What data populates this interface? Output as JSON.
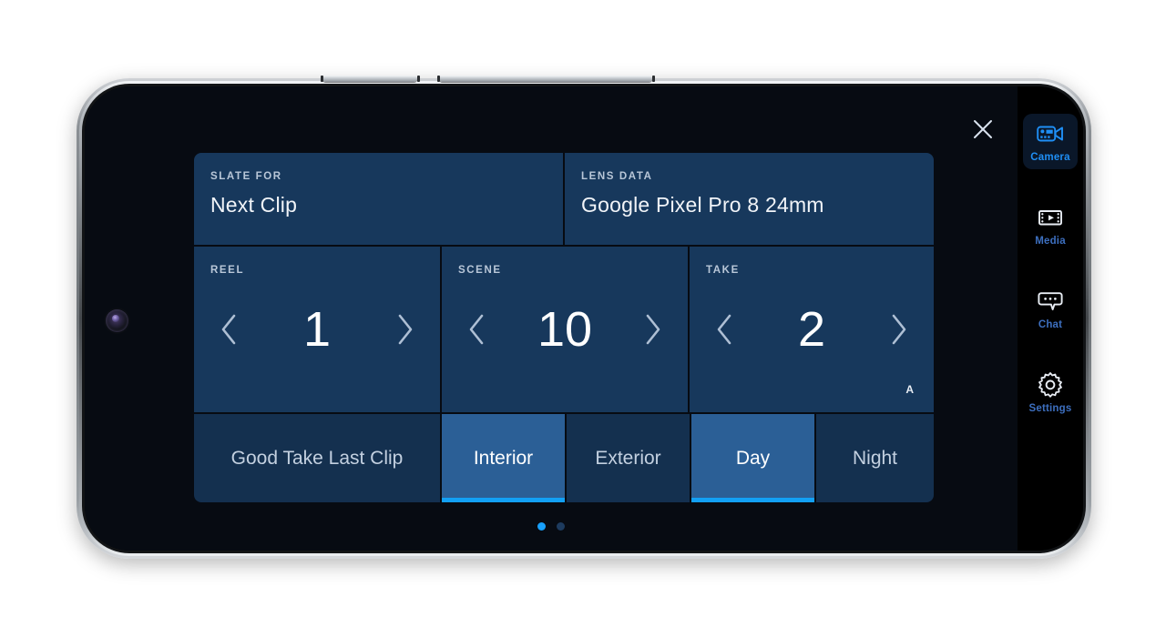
{
  "app": {
    "screen_background": "#070b12",
    "panel_color": "#17385c",
    "accent_color": "#12a0f5",
    "active_tile_color": "#2b5f96"
  },
  "close_button": {
    "icon": "close-icon",
    "label": "Close"
  },
  "slate": {
    "info": [
      {
        "label": "SLATE FOR",
        "value": "Next Clip",
        "name": "slate-for"
      },
      {
        "label": "LENS DATA",
        "value": "Google Pixel Pro 8 24mm",
        "name": "lens-data"
      }
    ],
    "steppers": [
      {
        "label": "REEL",
        "value": "1",
        "prev_icon": "chevron-left-icon",
        "next_icon": "chevron-right-icon"
      },
      {
        "label": "SCENE",
        "value": "10",
        "prev_icon": "chevron-left-icon",
        "next_icon": "chevron-right-icon"
      },
      {
        "label": "TAKE",
        "value": "2",
        "suffix": "A",
        "prev_icon": "chevron-left-icon",
        "next_icon": "chevron-right-icon"
      }
    ],
    "toggles": [
      {
        "label": "Good Take Last Clip",
        "active": false
      },
      {
        "label": "Interior",
        "active": true
      },
      {
        "label": "Exterior",
        "active": false
      },
      {
        "label": "Day",
        "active": true
      },
      {
        "label": "Night",
        "active": false
      }
    ]
  },
  "pagination": {
    "total": 2,
    "current": 1
  },
  "sidebar": {
    "items": [
      {
        "label": "Camera",
        "icon": "video-camera-icon",
        "active": true
      },
      {
        "label": "Media",
        "icon": "film-strip-icon",
        "active": false
      },
      {
        "label": "Chat",
        "icon": "chat-bubble-icon",
        "active": false
      },
      {
        "label": "Settings",
        "icon": "gear-icon",
        "active": false
      }
    ]
  }
}
